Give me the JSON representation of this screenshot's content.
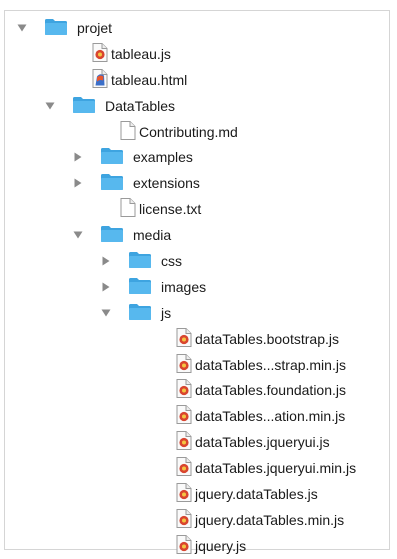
{
  "tree": [
    {
      "label": "projet",
      "type": "folder",
      "depth": 0,
      "expanded": true
    },
    {
      "label": "tableau.js",
      "type": "js",
      "depth": 1
    },
    {
      "label": "tableau.html",
      "type": "html",
      "depth": 1
    },
    {
      "label": "DataTables",
      "type": "folder",
      "depth": 1,
      "expanded": true
    },
    {
      "label": "Contributing.md",
      "type": "doc",
      "depth": 2
    },
    {
      "label": "examples",
      "type": "folder",
      "depth": 2,
      "expanded": false
    },
    {
      "label": "extensions",
      "type": "folder",
      "depth": 2,
      "expanded": false
    },
    {
      "label": "license.txt",
      "type": "doc",
      "depth": 2
    },
    {
      "label": "media",
      "type": "folder",
      "depth": 2,
      "expanded": true
    },
    {
      "label": "css",
      "type": "folder",
      "depth": 3,
      "expanded": false
    },
    {
      "label": "images",
      "type": "folder",
      "depth": 3,
      "expanded": false
    },
    {
      "label": "js",
      "type": "folder",
      "depth": 3,
      "expanded": true
    },
    {
      "label": "dataTables.bootstrap.js",
      "type": "js",
      "depth": 4
    },
    {
      "label": "dataTables...strap.min.js",
      "type": "js",
      "depth": 4
    },
    {
      "label": "dataTables.foundation.js",
      "type": "js",
      "depth": 4
    },
    {
      "label": "dataTables...ation.min.js",
      "type": "js",
      "depth": 4
    },
    {
      "label": "dataTables.jqueryui.js",
      "type": "js",
      "depth": 4
    },
    {
      "label": "dataTables.jqueryui.min.js",
      "type": "js",
      "depth": 4
    },
    {
      "label": "jquery.dataTables.js",
      "type": "js",
      "depth": 4
    },
    {
      "label": "jquery.dataTables.min.js",
      "type": "js",
      "depth": 4
    },
    {
      "label": "jquery.js",
      "type": "js",
      "depth": 4
    }
  ],
  "colors": {
    "folder": "#57b8ee",
    "folder_tab": "#3ea4e0",
    "triangle": "#8a8a8a",
    "js_badge": "#d9452f",
    "js_badge_inner": "#f4c542"
  },
  "icons": {
    "folder": "folder-icon",
    "js": "javascript-file-icon",
    "html": "html-file-icon",
    "doc": "text-document-icon",
    "expanded": "disclosure-triangle-down-icon",
    "collapsed": "disclosure-triangle-right-icon"
  }
}
